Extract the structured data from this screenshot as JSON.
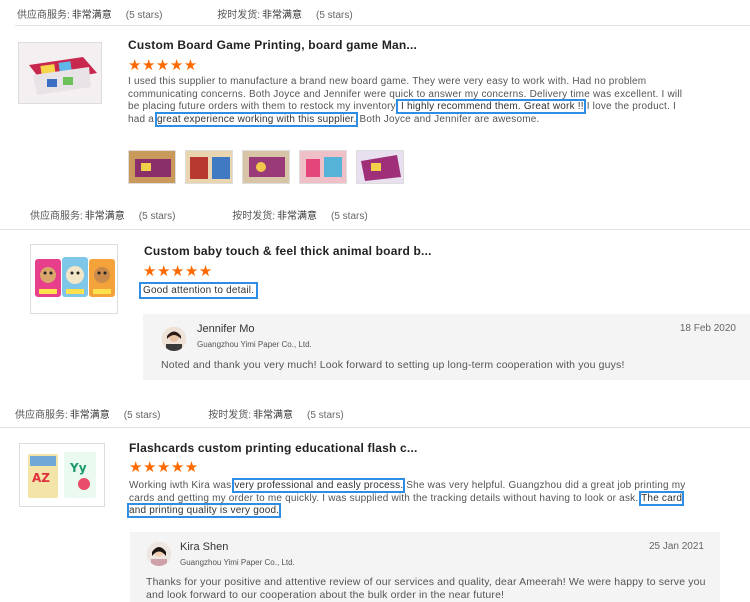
{
  "rating_labels": {
    "supplier_service": "供应商服务:",
    "on_time": "按时发货:",
    "value": "非常满意",
    "stars_text": "(5 stars)"
  },
  "reviews": [
    {
      "title": "Custom Board Game Printing, board game Man...",
      "stars": "★★★★★",
      "text_parts": [
        {
          "t": "I used this supplier to manufacture a brand new board game. They were very easy to work with. Had no problem communicating concerns. Both Joyce and Jennifer were quick to answer my concerns. Delivery time was excellent. I will be placing future orders with them to restock my inventory.",
          "hl": false
        },
        {
          "t": " I highly recommend them. Great work !!",
          "hl": true
        },
        {
          "t": " I love the product. I had a ",
          "hl": false
        },
        {
          "t": "great experience working with this supplier.",
          "hl": true
        },
        {
          "t": " Both Joyce and Jennifer are awesome.",
          "hl": false
        }
      ]
    },
    {
      "title": "Custom baby touch & feel thick animal board b...",
      "stars": "★★★★★",
      "text_parts": [
        {
          "t": "Good attention to detail.",
          "hl": true
        }
      ],
      "reply": {
        "name": "Jennifer Mo",
        "company": "Guangzhou Yimi Paper Co., Ltd.",
        "date": "18 Feb 2020",
        "text": "Noted and thank you very much! Look forward to setting up long-term cooperation with you guys!"
      }
    },
    {
      "title": "Flashcards custom printing educational flash c...",
      "stars": "★★★★★",
      "text_parts": [
        {
          "t": "Working iwth Kira was ",
          "hl": false
        },
        {
          "t": "very professional and easly process.",
          "hl": true
        },
        {
          "t": " She was very helpful. Guangzhou did a great job printing my cards and getting my order to me quickly.  I was supplied with the tracking details without having to look or ask. ",
          "hl": false
        },
        {
          "t": "The card and printing quality is very good.",
          "hl": true
        }
      ],
      "reply": {
        "name": "Kira Shen",
        "company": "Guangzhou Yimi Paper Co., Ltd.",
        "date": "25 Jan 2021",
        "text": "Thanks for your positive and attentive review of our services and quality, dear Ameerah! We were happy to serve you and look forward to our cooperation about the bulk order in the near future!"
      }
    }
  ]
}
